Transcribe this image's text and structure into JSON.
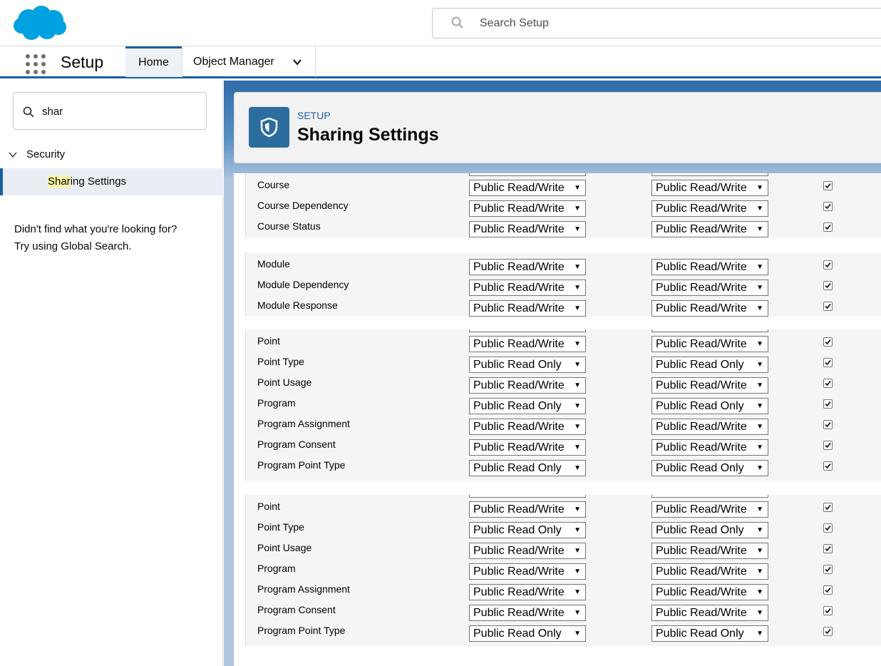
{
  "header": {
    "search_placeholder": "Search Setup"
  },
  "nav": {
    "app_name": "Setup",
    "tabs": [
      {
        "label": "Home"
      },
      {
        "label": "Object Manager"
      }
    ]
  },
  "sidebar": {
    "quick_find_value": "shar",
    "tree": {
      "parent_label": "Security",
      "child_label_highlight": "Shar",
      "child_label_rest": "ing Settings"
    },
    "not_found_line1": "Didn't find what you're looking for?",
    "not_found_line2": "Try using Global Search."
  },
  "page": {
    "eyebrow": "SETUP",
    "title": "Sharing Settings"
  },
  "blocks": [
    {
      "rows": [
        {
          "name": "Course",
          "internal": "Public Read/Write",
          "external": "Public Read/Write",
          "checked": true
        },
        {
          "name": "Course Dependency",
          "internal": "Public Read/Write",
          "external": "Public Read/Write",
          "checked": true
        },
        {
          "name": "Course Status",
          "internal": "Public Read/Write",
          "external": "Public Read/Write",
          "checked": true
        }
      ]
    },
    {
      "rows": [
        {
          "name": "Module",
          "internal": "Public Read/Write",
          "external": "Public Read/Write",
          "checked": true
        },
        {
          "name": "Module Dependency",
          "internal": "Public Read/Write",
          "external": "Public Read/Write",
          "checked": true
        },
        {
          "name": "Module Response",
          "internal": "Public Read/Write",
          "external": "Public Read/Write",
          "checked": true
        }
      ]
    },
    {
      "rows": [
        {
          "name": "Point",
          "internal": "Public Read/Write",
          "external": "Public Read/Write",
          "checked": true
        },
        {
          "name": "Point Type",
          "internal": "Public Read Only",
          "external": "Public Read Only",
          "checked": true
        },
        {
          "name": "Point Usage",
          "internal": "Public Read/Write",
          "external": "Public Read/Write",
          "checked": true
        },
        {
          "name": "Program",
          "internal": "Public Read Only",
          "external": "Public Read Only",
          "checked": true
        },
        {
          "name": "Program Assignment",
          "internal": "Public Read/Write",
          "external": "Public Read/Write",
          "checked": true
        },
        {
          "name": "Program Consent",
          "internal": "Public Read/Write",
          "external": "Public Read/Write",
          "checked": true
        },
        {
          "name": "Program Point Type",
          "internal": "Public Read Only",
          "external": "Public Read Only",
          "checked": true
        }
      ]
    },
    {
      "rows": [
        {
          "name": "Point",
          "internal": "Public Read/Write",
          "external": "Public Read/Write",
          "checked": true
        },
        {
          "name": "Point Type",
          "internal": "Public Read Only",
          "external": "Public Read Only",
          "checked": true
        },
        {
          "name": "Point Usage",
          "internal": "Public Read/Write",
          "external": "Public Read/Write",
          "checked": true
        },
        {
          "name": "Program",
          "internal": "Public Read/Write",
          "external": "Public Read/Write",
          "checked": true
        },
        {
          "name": "Program Assignment",
          "internal": "Public Read/Write",
          "external": "Public Read/Write",
          "checked": true
        },
        {
          "name": "Program Consent",
          "internal": "Public Read/Write",
          "external": "Public Read/Write",
          "checked": true
        },
        {
          "name": "Program Point Type",
          "internal": "Public Read Only",
          "external": "Public Read Only",
          "checked": true
        }
      ]
    }
  ],
  "colors": {
    "brand": "#1b5f9e",
    "cloud": "#00a1e0",
    "highlight": "#fbf6a8"
  }
}
